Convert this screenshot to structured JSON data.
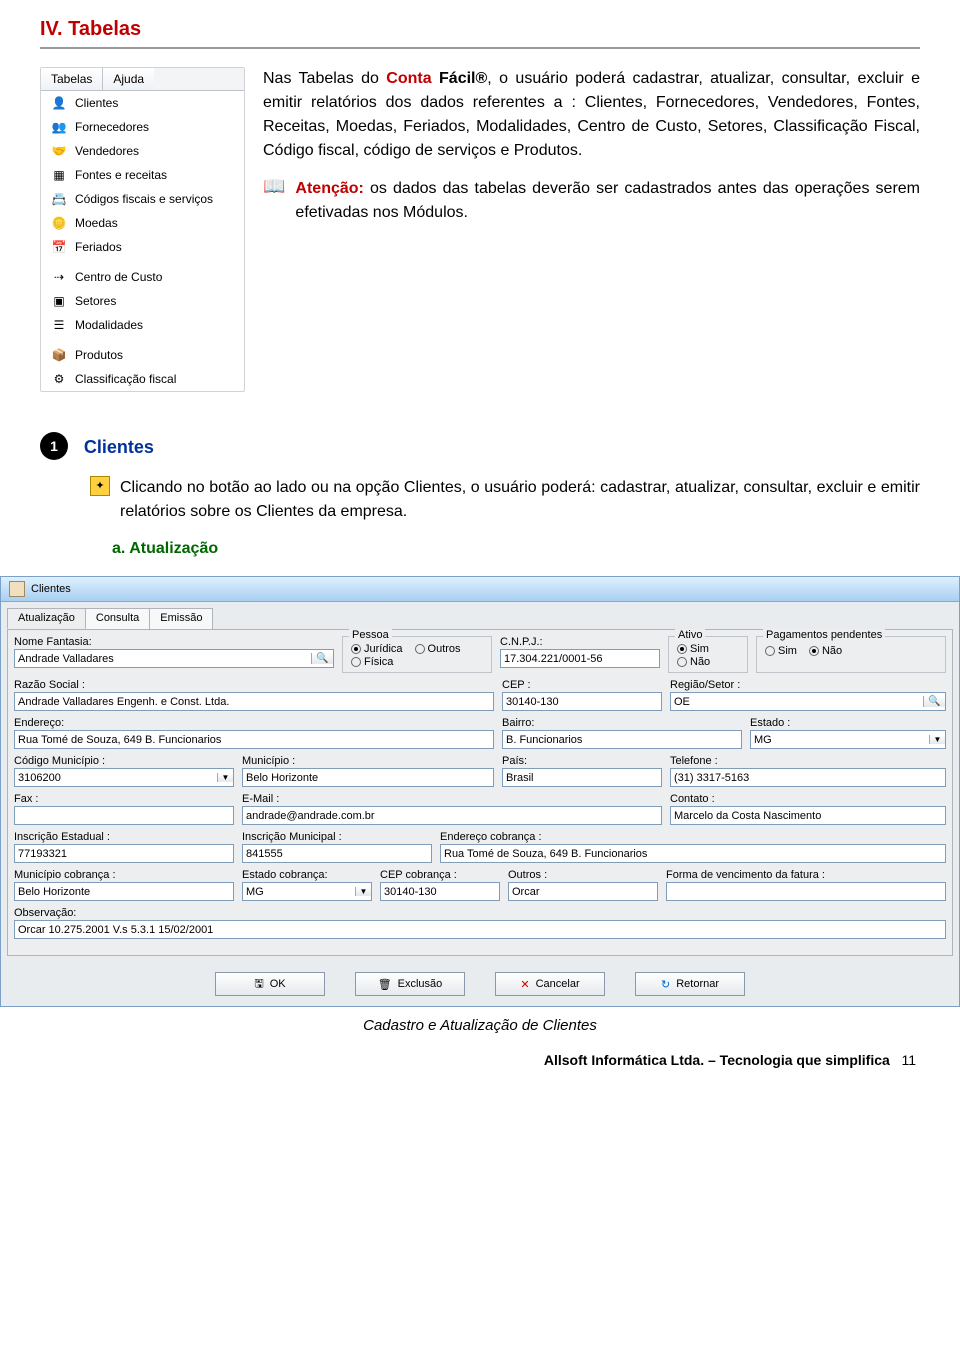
{
  "heading": "IV. Tabelas",
  "menu": {
    "tabs": [
      "Tabelas",
      "Ajuda"
    ],
    "items": [
      "Clientes",
      "Fornecedores",
      "Vendedores",
      "Fontes e receitas",
      "Códigos fiscais e serviços",
      "Moedas",
      "Feriados",
      "Centro de Custo",
      "Setores",
      "Modalidades",
      "Produtos",
      "Classificação fiscal"
    ]
  },
  "para1_pre": "Nas Tabelas do ",
  "brand_c": "Conta ",
  "brand_f": "Fácil®",
  "para1_post": ", o usuário poderá cadastrar, atualizar, consultar, excluir e emitir relatórios dos dados referentes a : Clientes, Fornecedores, Vendedores, Fontes, Receitas, Moedas, Feriados, Modalidades, Centro de Custo, Setores, Classificação Fiscal, Código fiscal, código de serviços e Produtos.",
  "atencao_label": "Atenção:",
  "atencao_text": " os dados das tabelas deverão ser cadastrados antes das operações serem efetivadas nos Módulos.",
  "sec_num": "1",
  "sec_title": "Clientes",
  "para2": "Clicando no botão ao lado ou na opção Clientes, o usuário poderá: cadastrar, atualizar, consultar, excluir e emitir relatórios sobre os Clientes da empresa.",
  "sub_a": "a. Atualização",
  "dialog": {
    "title": "Clientes",
    "tabs": [
      "Atualização",
      "Consulta",
      "Emissão"
    ],
    "labels": {
      "nome_fantasia": "Nome Fantasia:",
      "pessoa": "Pessoa",
      "cnpj": "C.N.P.J.:",
      "ativo": "Ativo",
      "pagamentos": "Pagamentos pendentes",
      "razao": "Razão Social  :",
      "cep": "CEP :",
      "regiao": "Região/Setor :",
      "endereco": "Endereço:",
      "bairro": "Bairro:",
      "estado": "Estado :",
      "cod_mun": "Código Município :",
      "municipio": "Município :",
      "pais": "País:",
      "telefone": "Telefone :",
      "fax": "Fax :",
      "email": "E-Mail :",
      "contato": "Contato :",
      "insc_est": "Inscrição Estadual :",
      "insc_mun": "Inscrição Municipal :",
      "end_cob": "Endereço cobrança :",
      "mun_cob": "Município cobrança :",
      "est_cob": "Estado cobrança:",
      "cep_cob": "CEP cobrança :",
      "outros": "Outros :",
      "forma_venc": "Forma de vencimento da fatura :",
      "obs": "Observação:"
    },
    "values": {
      "nome_fantasia": "Andrade Valladares",
      "cnpj": "17.304.221/0001-56",
      "razao": "Andrade Valladares Engenh. e Const. Ltda.",
      "cep": "30140-130",
      "regiao": "OE",
      "endereco": "Rua Tomé de Souza, 649  B. Funcionarios",
      "bairro": "B. Funcionarios",
      "estado": "MG",
      "cod_mun": "3106200",
      "municipio": "Belo Horizonte",
      "pais": "Brasil",
      "telefone": "(31) 3317-5163",
      "fax": "",
      "email": "andrade@andrade.com.br",
      "contato": "Marcelo da Costa Nascimento",
      "insc_est": "77193321",
      "insc_mun": "841555",
      "end_cob": "Rua Tomé de Souza, 649  B. Funcionarios",
      "mun_cob": "Belo Horizonte",
      "est_cob": "MG",
      "cep_cob": "30140-130",
      "outros": "Orcar",
      "forma_venc": "",
      "obs": "Orcar 10.275.2001  V.s 5.3.1 15/02/2001"
    },
    "pessoa_opts": [
      "Jurídica",
      "Outros",
      "Física"
    ],
    "ativo_opts": [
      "Sim",
      "Não"
    ],
    "pag_opts": [
      "Sim",
      "Não"
    ],
    "buttons": [
      "OK",
      "Exclusão",
      "Cancelar",
      "Retornar"
    ]
  },
  "caption": "Cadastro e Atualização de Clientes",
  "footer_bold": "Allsoft Informática Ltda. – Tecnologia que simplifica",
  "footer_page": "11"
}
